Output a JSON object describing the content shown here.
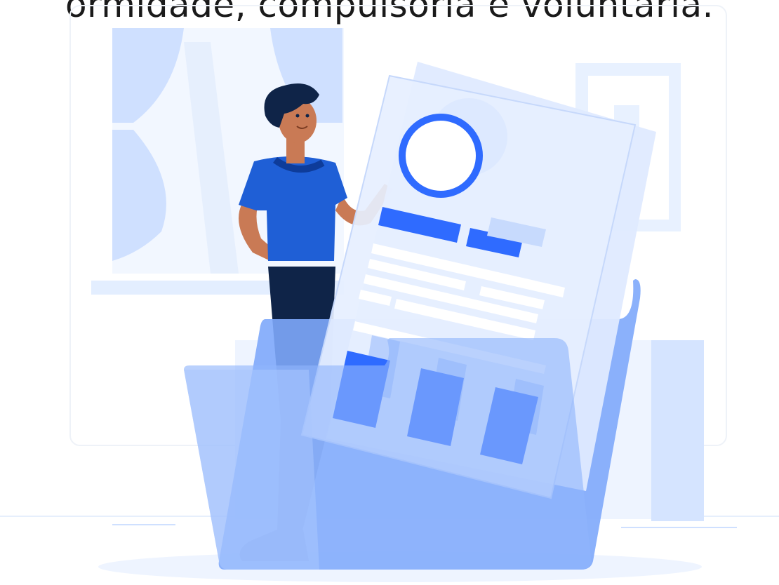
{
  "caption": {
    "text": "ormidade, compulsória e voluntária."
  },
  "colors": {
    "accent": "#2f6bff",
    "light_blue": "#cfe0ff",
    "pale_blue": "#e8f1ff",
    "navy": "#0f2448",
    "shirt": "#1f5fd6",
    "skin": "#c97a55",
    "text": "#1a1a1a"
  },
  "illustration": {
    "icons": [
      "person-icon",
      "document-icon",
      "folder-icon",
      "window-icon",
      "avatar-circle-icon",
      "bar-chart-icon"
    ]
  }
}
